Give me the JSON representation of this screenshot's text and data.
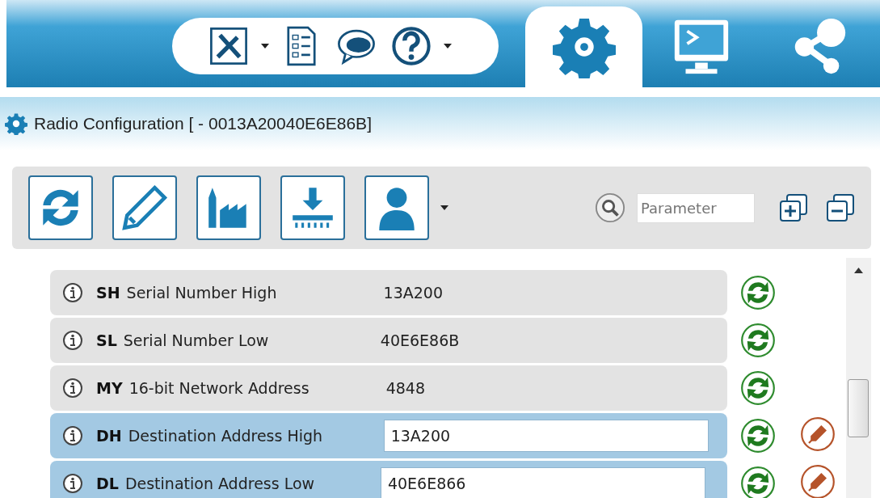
{
  "tabs": [
    {
      "kind": "settings",
      "selected": true
    },
    {
      "kind": "console",
      "selected": false
    },
    {
      "kind": "network",
      "selected": false
    }
  ],
  "header": {
    "title": "Radio Configuration [  - 0013A20040E6E86B]"
  },
  "search": {
    "placeholder": "Parameter"
  },
  "parameters": [
    {
      "kind": "readonly",
      "code": "SH",
      "name": "Serial Number High",
      "value": "13A200"
    },
    {
      "kind": "readonly",
      "code": "SL",
      "name": "Serial Number Low",
      "value": "40E6E86B"
    },
    {
      "kind": "readonly",
      "code": "MY",
      "name": "16-bit Network Address",
      "value": "4848"
    },
    {
      "kind": "editable",
      "code": "DH",
      "name": "Destination Address High",
      "value": "13A200"
    },
    {
      "kind": "editable",
      "code": "DL",
      "name": "Destination Address Low",
      "value": "40E6E866"
    }
  ]
}
